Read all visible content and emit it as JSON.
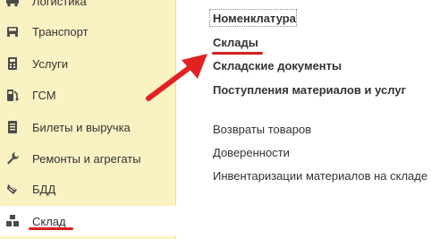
{
  "sidebar": {
    "items": [
      {
        "label": "Логистика",
        "icon": "truck-icon"
      },
      {
        "label": "Транспорт",
        "icon": "car-icon"
      },
      {
        "label": "Услуги",
        "icon": "calculator-icon"
      },
      {
        "label": "ГСМ",
        "icon": "fuel-icon"
      },
      {
        "label": "Билеты и выручка",
        "icon": "tickets-icon"
      },
      {
        "label": "Ремонты и агрегаты",
        "icon": "wrench-icon"
      },
      {
        "label": "БДД",
        "icon": "traffic-cone-icon"
      },
      {
        "label": "Склад",
        "icon": "warehouse-icon",
        "active": true
      }
    ]
  },
  "main": {
    "links_bold": [
      "Номенклатура",
      "Склады",
      "Складские документы",
      "Поступления материалов и услуг"
    ],
    "links_regular": [
      "Возвраты товаров",
      "Доверенности",
      "Инвентаризации материалов на складе"
    ]
  },
  "colors": {
    "sidebar_bg": "#fbf2c4",
    "annotation_red": "#d81e1e"
  }
}
